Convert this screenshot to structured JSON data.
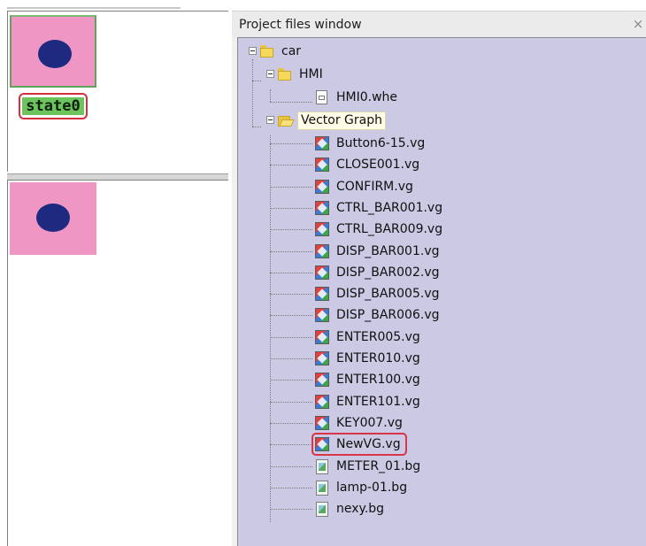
{
  "left_panel": {
    "state_label": "state0"
  },
  "project_window": {
    "title": "Project files window",
    "close_glyph": "×",
    "tree": {
      "root": "car",
      "hmi_folder": "HMI",
      "hmi_file": "HMI0.whe",
      "vector_folder": "Vector Graph",
      "vector_files": [
        "Button6-15.vg",
        "CLOSE001.vg",
        "CONFIRM.vg",
        "CTRL_BAR001.vg",
        "CTRL_BAR009.vg",
        "DISP_BAR001.vg",
        "DISP_BAR002.vg",
        "DISP_BAR005.vg",
        "DISP_BAR006.vg",
        "ENTER005.vg",
        "ENTER010.vg",
        "ENTER100.vg",
        "ENTER101.vg",
        "KEY007.vg",
        "NewVG.vg"
      ],
      "bitmap_files": [
        "METER_01.bg",
        "lamp-01.bg",
        "nexy.bg"
      ]
    }
  },
  "colors": {
    "tree_background": "#cbc9e3",
    "preview_pink": "#ef96c4",
    "dot_navy": "#1e2a80",
    "state_green": "#6cc45c",
    "highlight_red": "#d8344a"
  },
  "icons": {
    "folder": "folder-icon",
    "open_folder": "folder-open-icon",
    "hmi_file": "hmi-file-icon",
    "vector_graph": "vector-graph-icon",
    "bitmap": "bitmap-icon"
  }
}
